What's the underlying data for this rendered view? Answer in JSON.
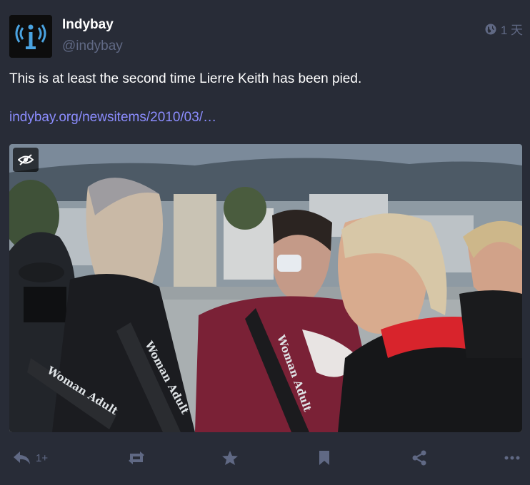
{
  "account": {
    "display_name": "Indybay",
    "handle": "@indybay"
  },
  "status": {
    "time": "1 天",
    "text": "This is at least the second time Lierre Keith has been pied.",
    "link": "indybay.org/newsitems/2010/03/…"
  },
  "actions": {
    "reply_count": "1+"
  },
  "media": {
    "sash_text": "Woman Adult"
  },
  "colors": {
    "background": "#282c37",
    "muted": "#606984",
    "link": "#8c8dff"
  }
}
